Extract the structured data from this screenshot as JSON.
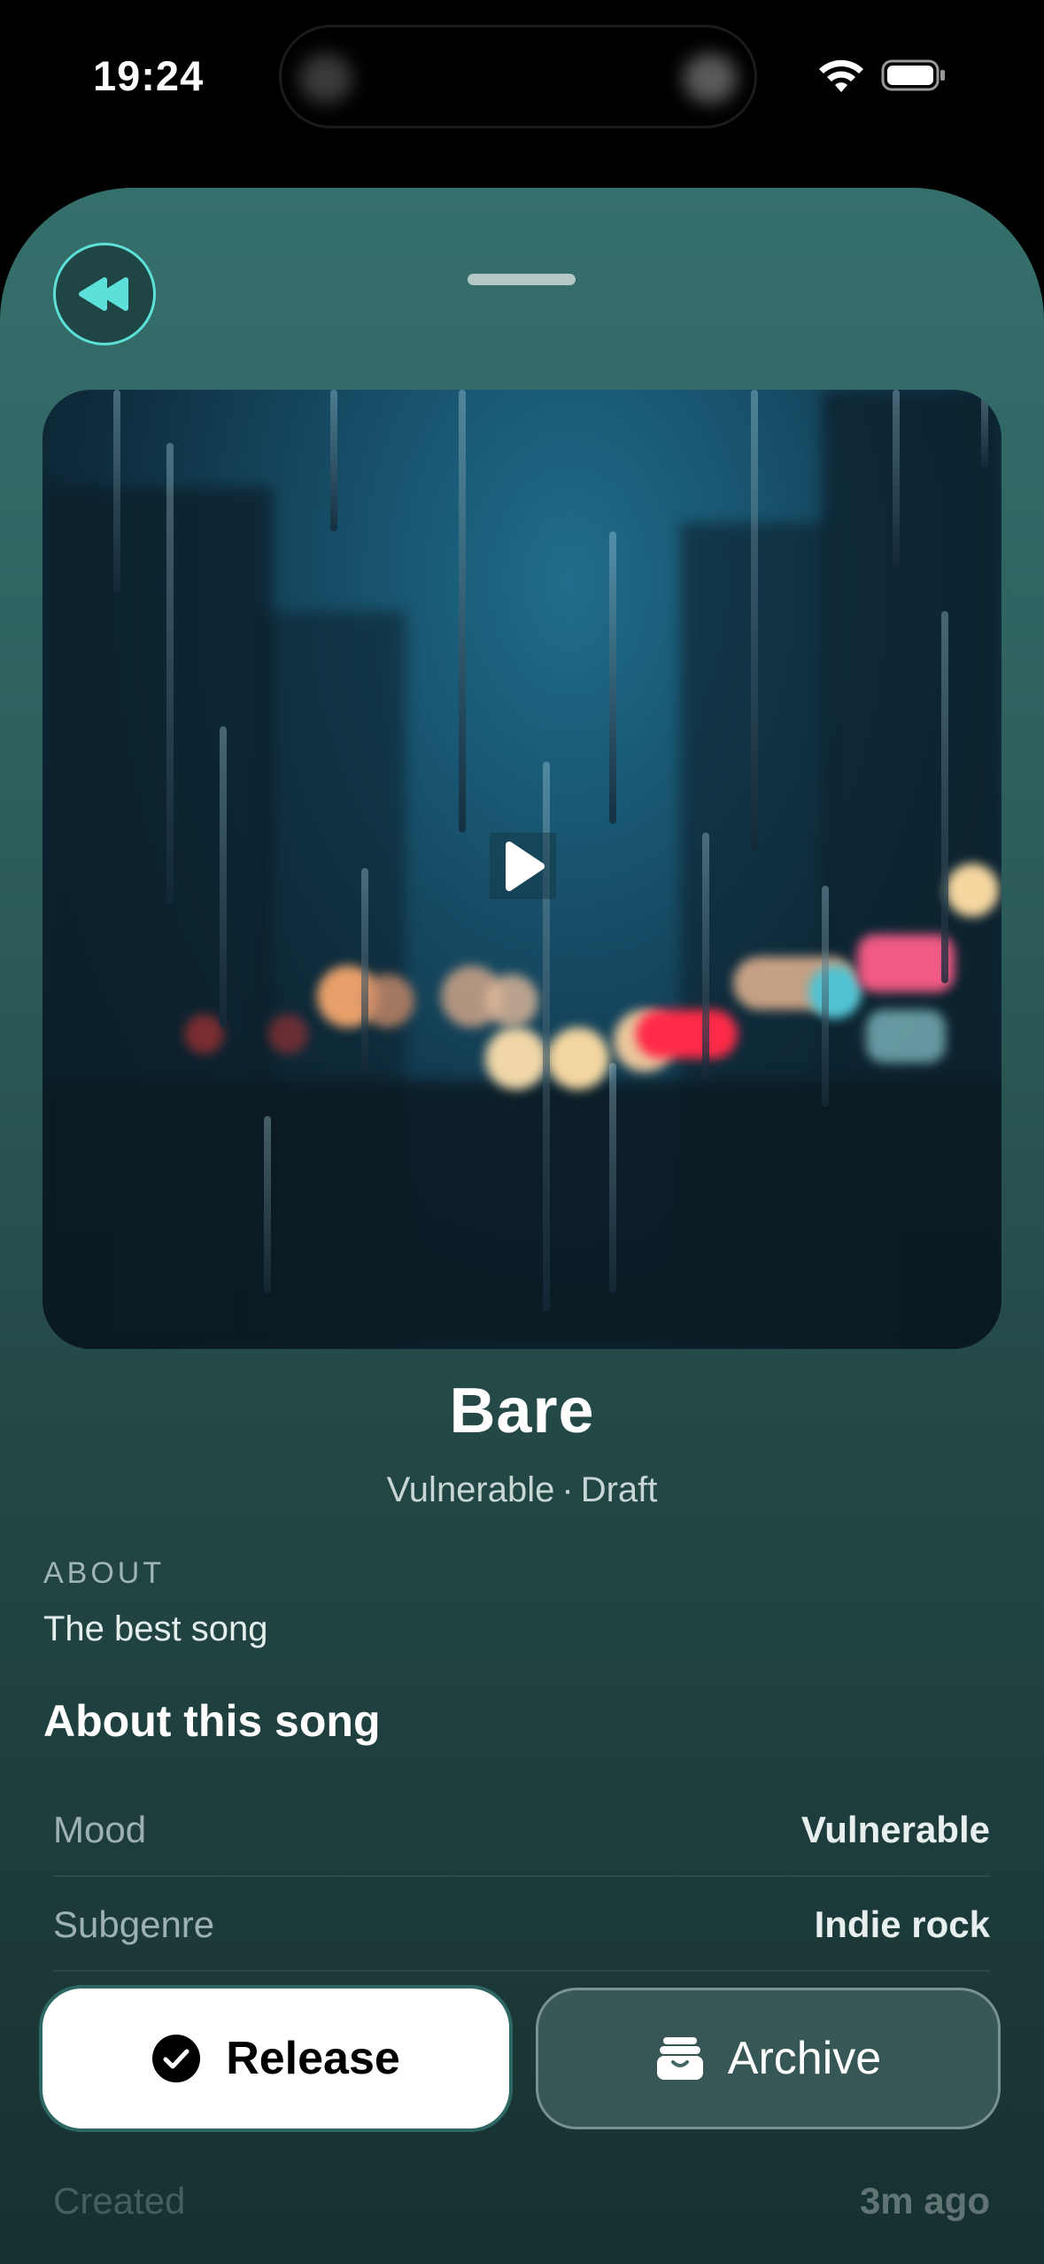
{
  "status_bar": {
    "time": "19:24"
  },
  "colors": {
    "accent": "#5de0d8",
    "sheet_top": "#356f6c",
    "sheet_bottom": "#163030"
  },
  "song": {
    "title": "Bare",
    "mood": "Vulnerable",
    "separator": "·",
    "status": "Draft"
  },
  "about": {
    "label": "ABOUT",
    "text": "The best song"
  },
  "details": {
    "section_title": "About this song",
    "rows": [
      {
        "label": "Mood",
        "value": "Vulnerable"
      },
      {
        "label": "Subgenre",
        "value": "Indie rock"
      },
      {
        "label": "Created",
        "value": "3m ago"
      }
    ]
  },
  "actions": {
    "release_label": "Release",
    "archive_label": "Archive"
  },
  "icons": {
    "back": "rewind-icon",
    "play": "play-icon",
    "release": "checkmark-circle-icon",
    "archive": "archive-box-icon"
  }
}
